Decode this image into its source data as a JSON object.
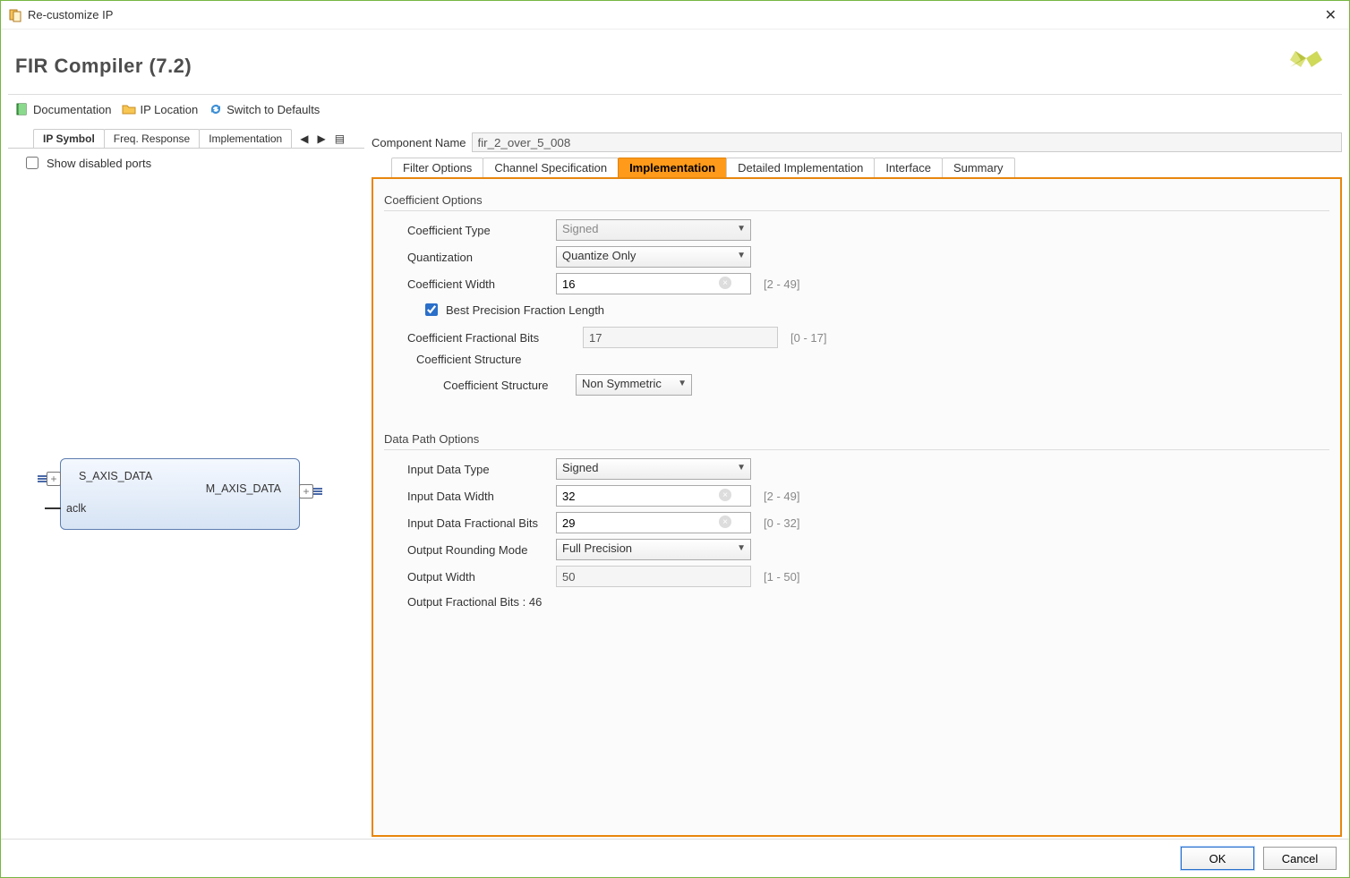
{
  "window": {
    "title": "Re-customize IP"
  },
  "header": {
    "title": "FIR Compiler (7.2)"
  },
  "toolbar": {
    "documentation": "Documentation",
    "ip_location": "IP Location",
    "switch_defaults": "Switch to Defaults"
  },
  "left": {
    "tabs": [
      "IP Symbol",
      "Freq. Response",
      "Implementation"
    ],
    "active_tab": 0,
    "show_disabled_ports": "Show disabled ports",
    "show_disabled_ports_checked": false,
    "ip_block": {
      "port_in": "S_AXIS_DATA",
      "port_out": "M_AXIS_DATA",
      "aclk": "aclk"
    }
  },
  "comp_name_label": "Component Name",
  "comp_name_value": "fir_2_over_5_008",
  "tabs": [
    "Filter Options",
    "Channel Specification",
    "Implementation",
    "Detailed Implementation",
    "Interface",
    "Summary"
  ],
  "active_tab": 2,
  "coeff": {
    "section": "Coefficient Options",
    "type_label": "Coefficient Type",
    "type_value": "Signed",
    "quant_label": "Quantization",
    "quant_value": "Quantize Only",
    "width_label": "Coefficient Width",
    "width_value": "16",
    "width_hint": "[2 - 49]",
    "best_precision_label": "Best Precision Fraction Length",
    "best_precision_checked": true,
    "frac_bits_label": "Coefficient Fractional Bits",
    "frac_bits_value": "17",
    "frac_bits_hint": "[0 - 17]",
    "struct_title": "Coefficient Structure",
    "struct_label": "Coefficient Structure",
    "struct_value": "Non Symmetric"
  },
  "dp": {
    "section": "Data Path Options",
    "in_type_label": "Input Data Type",
    "in_type_value": "Signed",
    "in_width_label": "Input Data Width",
    "in_width_value": "32",
    "in_width_hint": "[2 - 49]",
    "in_frac_label": "Input Data Fractional Bits",
    "in_frac_value": "29",
    "in_frac_hint": "[0 - 32]",
    "round_label": "Output Rounding Mode",
    "round_value": "Full Precision",
    "out_width_label": "Output Width",
    "out_width_value": "50",
    "out_width_hint": "[1 - 50]",
    "out_frac_label": "Output Fractional Bits : 46"
  },
  "buttons": {
    "ok": "OK",
    "cancel": "Cancel"
  }
}
